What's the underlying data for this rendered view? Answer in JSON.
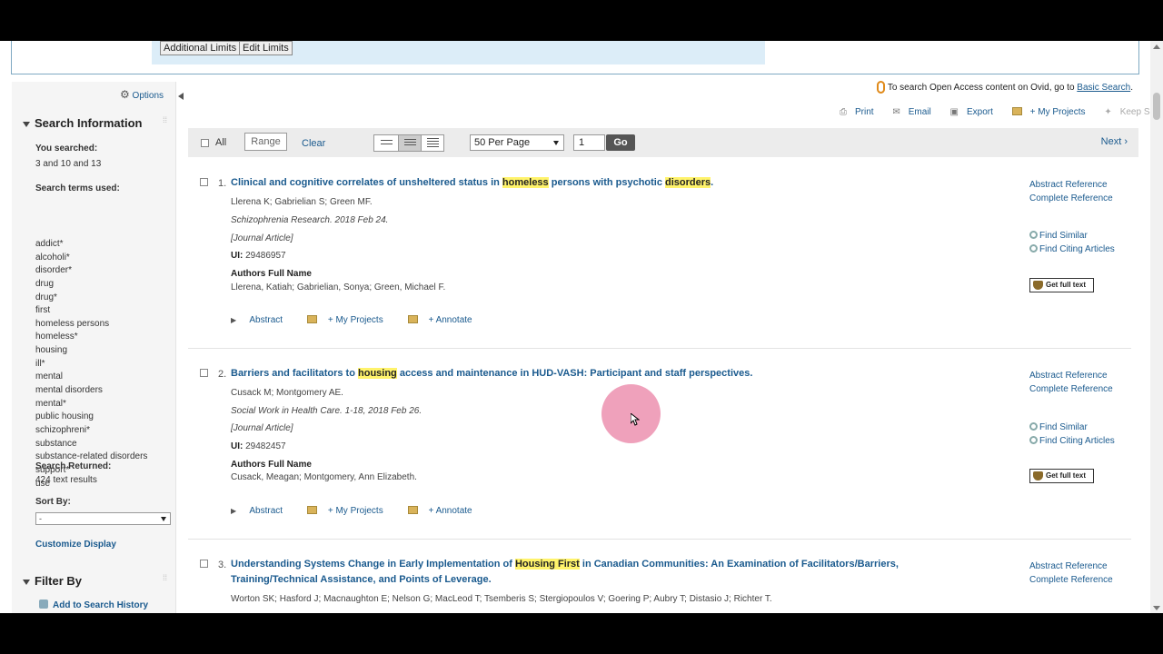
{
  "limits": {
    "additional_label": "Additional Limits",
    "edit_label": "Edit Limits"
  },
  "options_label": "Options",
  "search_info": {
    "heading": "Search Information",
    "you_searched_label": "You searched:",
    "you_searched_value": "3 and 10 and 13",
    "terms_label": "Search terms used:",
    "terms": [
      "addict*",
      "alcoholi*",
      "disorder*",
      "drug",
      "drug*",
      "first",
      "homeless persons",
      "homeless*",
      "housing",
      "ill*",
      "mental",
      "mental disorders",
      "mental*",
      "public housing",
      "schizophreni*",
      "substance",
      "substance-related disorders",
      "support*",
      "use"
    ],
    "returned_label": "Search Returned:",
    "returned_value": "424 text results",
    "sort_label": "Sort By:",
    "sort_value": "-",
    "customize_label": "Customize Display"
  },
  "filter": {
    "heading": "Filter By",
    "add_history_label": "Add to Search History"
  },
  "open_access": {
    "text": "To search Open Access content on Ovid, go to ",
    "link": "Basic Search",
    "end": "."
  },
  "tools": {
    "print": "Print",
    "email": "Email",
    "export": "Export",
    "projects": "+ My Projects",
    "keep": "Keep Selected"
  },
  "toolbar": {
    "all_label": "All",
    "range_label": "Range",
    "clear_label": "Clear",
    "perpage_value": "50 Per Page",
    "page_value": "1",
    "go_label": "Go",
    "next_label": "Next ›"
  },
  "results": [
    {
      "num": "1.",
      "title_parts": [
        "Clinical and cognitive correlates of unsheltered status in ",
        "homeless",
        " persons with psychotic ",
        "disorders",
        "."
      ],
      "authors": "Llerena K; Gabrielian S; Green MF.",
      "source": "Schizophrenia Research. 2018 Feb 24.",
      "type": "[Journal Article]",
      "ui_label": "UI:",
      "ui": "29486957",
      "afn_label": "Authors Full Name",
      "afn": "Llerena, Katiah; Gabrielian, Sonya; Green, Michael F."
    },
    {
      "num": "2.",
      "title_parts": [
        "Barriers and facilitators to ",
        "housing",
        " access and maintenance in HUD-VASH: Participant and staff perspectives."
      ],
      "authors": "Cusack M; Montgomery AE.",
      "source": "Social Work in Health Care. 1-18, 2018 Feb 26.",
      "type": "[Journal Article]",
      "ui_label": "UI:",
      "ui": "29482457",
      "afn_label": "Authors Full Name",
      "afn": "Cusack, Meagan; Montgomery, Ann Elizabeth."
    },
    {
      "num": "3.",
      "title_line1_parts": [
        "Understanding Systems Change in Early Implementation of ",
        "Housing First",
        " in Canadian Communities: An Examination of Facilitators/Barriers,"
      ],
      "title_line2": "Training/Technical Assistance, and Points of Leverage.",
      "authors": "Worton SK; Hasford J; Macnaughton E; Nelson G; MacLeod T; Tsemberis S; Stergiopoulos V; Goering P; Aubry T; Distasio J; Richter T."
    }
  ],
  "result_actions": {
    "abstract": "Abstract",
    "projects": "+ My Projects",
    "annotate": "+ Annotate"
  },
  "result_links": {
    "abstract_ref": "Abstract Reference",
    "complete_ref": "Complete Reference",
    "find_similar": "Find Similar",
    "find_citing": "Find Citing Articles",
    "full_text": "Get full text"
  }
}
